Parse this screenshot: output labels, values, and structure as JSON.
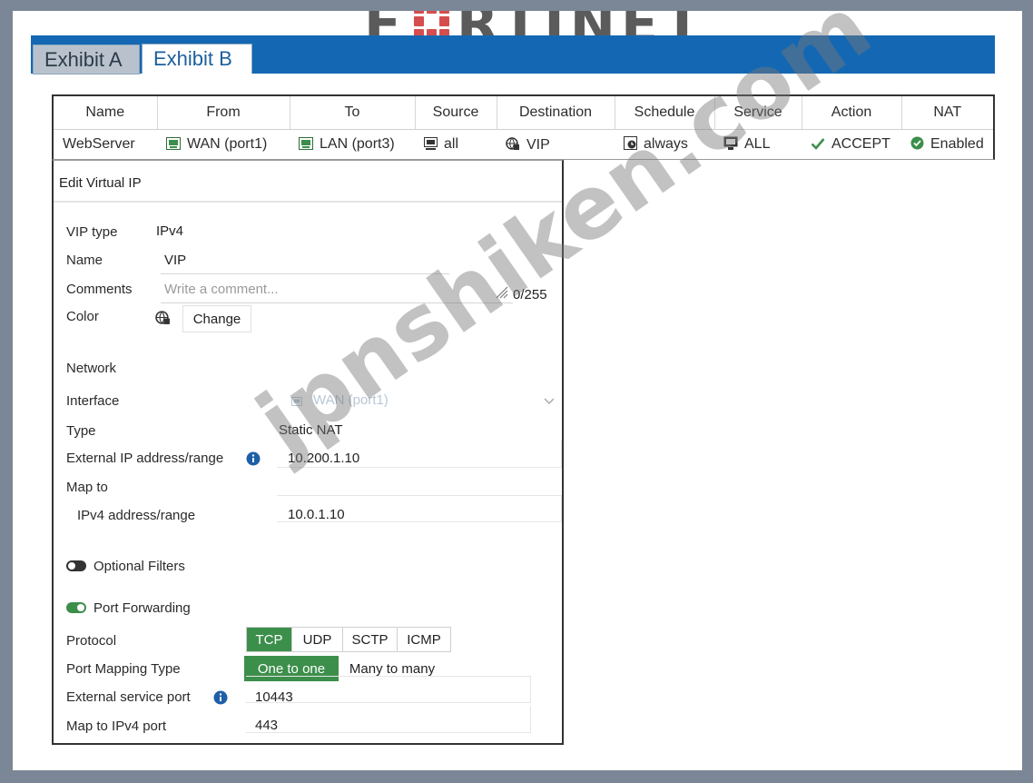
{
  "logo": {
    "text_left": "F",
    "text_right": "RTINET",
    "reg": "®"
  },
  "tabs": [
    {
      "label": "Exhibit A",
      "active": false
    },
    {
      "label": "Exhibit B",
      "active": true
    }
  ],
  "policy": {
    "columns": [
      "Name",
      "From",
      "To",
      "Source",
      "Destination",
      "Schedule",
      "Service",
      "Action",
      "NAT"
    ],
    "row": {
      "name": "WebServer",
      "from": "WAN (port1)",
      "to": "LAN (port3)",
      "source": "all",
      "destination": "VIP",
      "schedule": "always",
      "service": "ALL",
      "action": "ACCEPT",
      "nat": "Enabled"
    }
  },
  "vip": {
    "title": "Edit Virtual IP",
    "vip_type_label": "VIP type",
    "vip_type_value": "IPv4",
    "name_label": "Name",
    "name_value": "VIP",
    "comments_label": "Comments",
    "comments_placeholder": "Write a comment...",
    "comments_count": "0/255",
    "color_label": "Color",
    "color_button": "Change",
    "network_heading": "Network",
    "interface_label": "Interface",
    "interface_value": "WAN (port1)",
    "type_label": "Type",
    "type_value": "Static NAT",
    "ext_ip_label": "External IP address/range",
    "ext_ip_value": "10.200.1.10",
    "map_to_label": "Map to",
    "ipv4_range_label": "IPv4 address/range",
    "ipv4_range_value": "10.0.1.10",
    "optional_filters_label": "Optional Filters",
    "optional_filters_on": false,
    "port_forwarding_label": "Port Forwarding",
    "port_forwarding_on": true,
    "protocol_label": "Protocol",
    "protocols": [
      "TCP",
      "UDP",
      "SCTP",
      "ICMP"
    ],
    "protocol_selected": "TCP",
    "port_mapping_label": "Port Mapping Type",
    "port_mapping_options": [
      "One to one",
      "Many to many"
    ],
    "port_mapping_selected": "One to one",
    "ext_service_port_label": "External service port",
    "ext_service_port_value": "10443",
    "map_to_ipv4_port_label": "Map to IPv4 port",
    "map_to_ipv4_port_value": "443"
  },
  "watermark": "jpnshiken.com",
  "colors": {
    "tabbar": "#1468b3",
    "accent_green": "#3c8f4b",
    "info_blue": "#1e5fa8",
    "logo_red": "#d23a3a"
  }
}
